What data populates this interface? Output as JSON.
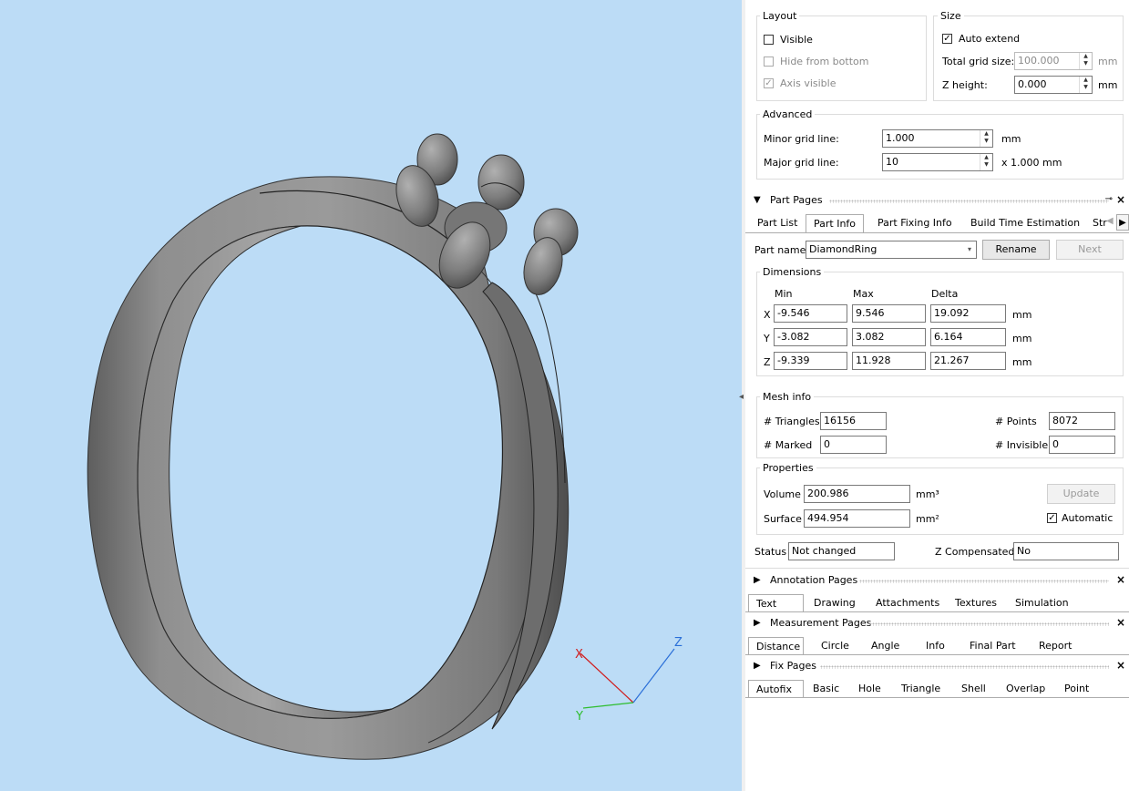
{
  "layout": {
    "title": "Layout",
    "visible": {
      "label": "Visible",
      "checked": false
    },
    "hide_from_bottom": {
      "label": "Hide from bottom",
      "checked": false
    },
    "axis_visible": {
      "label": "Axis visible",
      "checked": true
    }
  },
  "size": {
    "title": "Size",
    "auto_extend": {
      "label": "Auto extend",
      "checked": true
    },
    "total_grid_label": "Total grid size:",
    "total_grid_value": "100.000",
    "z_height_label": "Z height:",
    "z_height_value": "0.000",
    "unit": "mm"
  },
  "advanced": {
    "title": "Advanced",
    "minor_label": "Minor grid line:",
    "minor_value": "1.000",
    "minor_unit": "mm",
    "major_label": "Major grid line:",
    "major_value": "10",
    "major_unit": "x 1.000 mm"
  },
  "part_pages": {
    "title": "Part Pages",
    "tabs": [
      "Part List",
      "Part Info",
      "Part Fixing Info",
      "Build Time Estimation",
      "Str"
    ],
    "selected_tab": "Part Info",
    "part_name_label": "Part name",
    "part_name_value": "DiamondRing",
    "rename_label": "Rename",
    "next_label": "Next",
    "dimensions": {
      "title": "Dimensions",
      "col_min": "Min",
      "col_max": "Max",
      "col_delta": "Delta",
      "rows": [
        {
          "axis": "X",
          "min": "-9.546",
          "max": "9.546",
          "delta": "19.092",
          "unit": "mm"
        },
        {
          "axis": "Y",
          "min": "-3.082",
          "max": "3.082",
          "delta": "6.164",
          "unit": "mm"
        },
        {
          "axis": "Z",
          "min": "-9.339",
          "max": "11.928",
          "delta": "21.267",
          "unit": "mm"
        }
      ]
    },
    "mesh": {
      "title": "Mesh info",
      "triangles_label": "# Triangles",
      "triangles_value": "16156",
      "points_label": "# Points",
      "points_value": "8072",
      "marked_label": "# Marked",
      "marked_value": "0",
      "invisible_label": "# Invisible",
      "invisible_value": "0"
    },
    "properties": {
      "title": "Properties",
      "volume_label": "Volume",
      "volume_value": "200.986",
      "volume_unit": "mm³",
      "surface_label": "Surface",
      "surface_value": "494.954",
      "surface_unit": "mm²",
      "update_label": "Update",
      "automatic": {
        "label": "Automatic",
        "checked": true
      }
    },
    "status_label": "Status",
    "status_value": "Not changed",
    "zcomp_label": "Z Compensated",
    "zcomp_value": "No"
  },
  "annotation_pages": {
    "title": "Annotation Pages",
    "tabs": [
      "Text",
      "Drawing",
      "Attachments",
      "Textures",
      "Simulation"
    ],
    "selected_tab": "Text"
  },
  "measurement_pages": {
    "title": "Measurement Pages",
    "tabs": [
      "Distance",
      "Circle",
      "Angle",
      "Info",
      "Final Part",
      "Report"
    ],
    "selected_tab": "Distance"
  },
  "fix_pages": {
    "title": "Fix Pages",
    "tabs": [
      "Autofix",
      "Basic",
      "Hole",
      "Triangle",
      "Shell",
      "Overlap",
      "Point"
    ],
    "selected_tab": "Autofix"
  },
  "axis_triad": {
    "x": "X",
    "y": "Y",
    "z": "Z"
  },
  "colors": {
    "viewport_bg": "#bcdcf6",
    "ring": "#8c8c8c",
    "x_axis": "#d01e1e",
    "y_axis": "#2ebd2e",
    "z_axis": "#2a6fd8"
  },
  "icons": {
    "collapse": "triangle-down-icon",
    "expand": "triangle-right-icon",
    "close": "close-icon",
    "pin": "pin-icon"
  }
}
